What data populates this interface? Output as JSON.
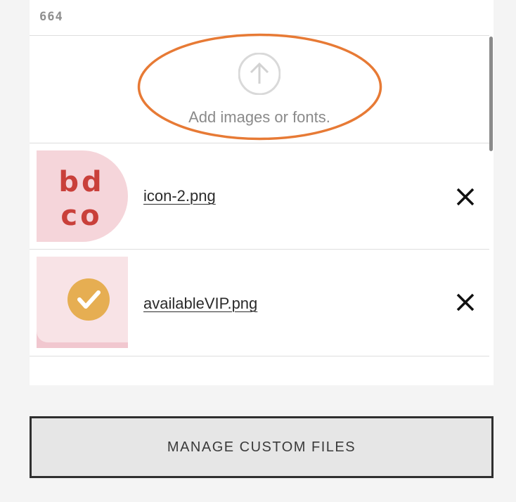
{
  "editor": {
    "line_number": "664"
  },
  "upload": {
    "label": "Add images or fonts.",
    "icon": "upload-arrow-icon"
  },
  "files": [
    {
      "name": "icon-2.png",
      "thumb_text": [
        "bd",
        "co"
      ],
      "thumb_bg": "#f5d5da",
      "thumb_fg": "#c9403a"
    },
    {
      "name": "availableVIP.png",
      "thumb_bg": "#f8e3e6",
      "badge_color": "#e6ae52"
    }
  ],
  "actions": {
    "manage_label": "MANAGE CUSTOM FILES"
  },
  "colors": {
    "annotation": "#e77a35",
    "background": "#f4f4f4",
    "panel": "#ffffff"
  }
}
